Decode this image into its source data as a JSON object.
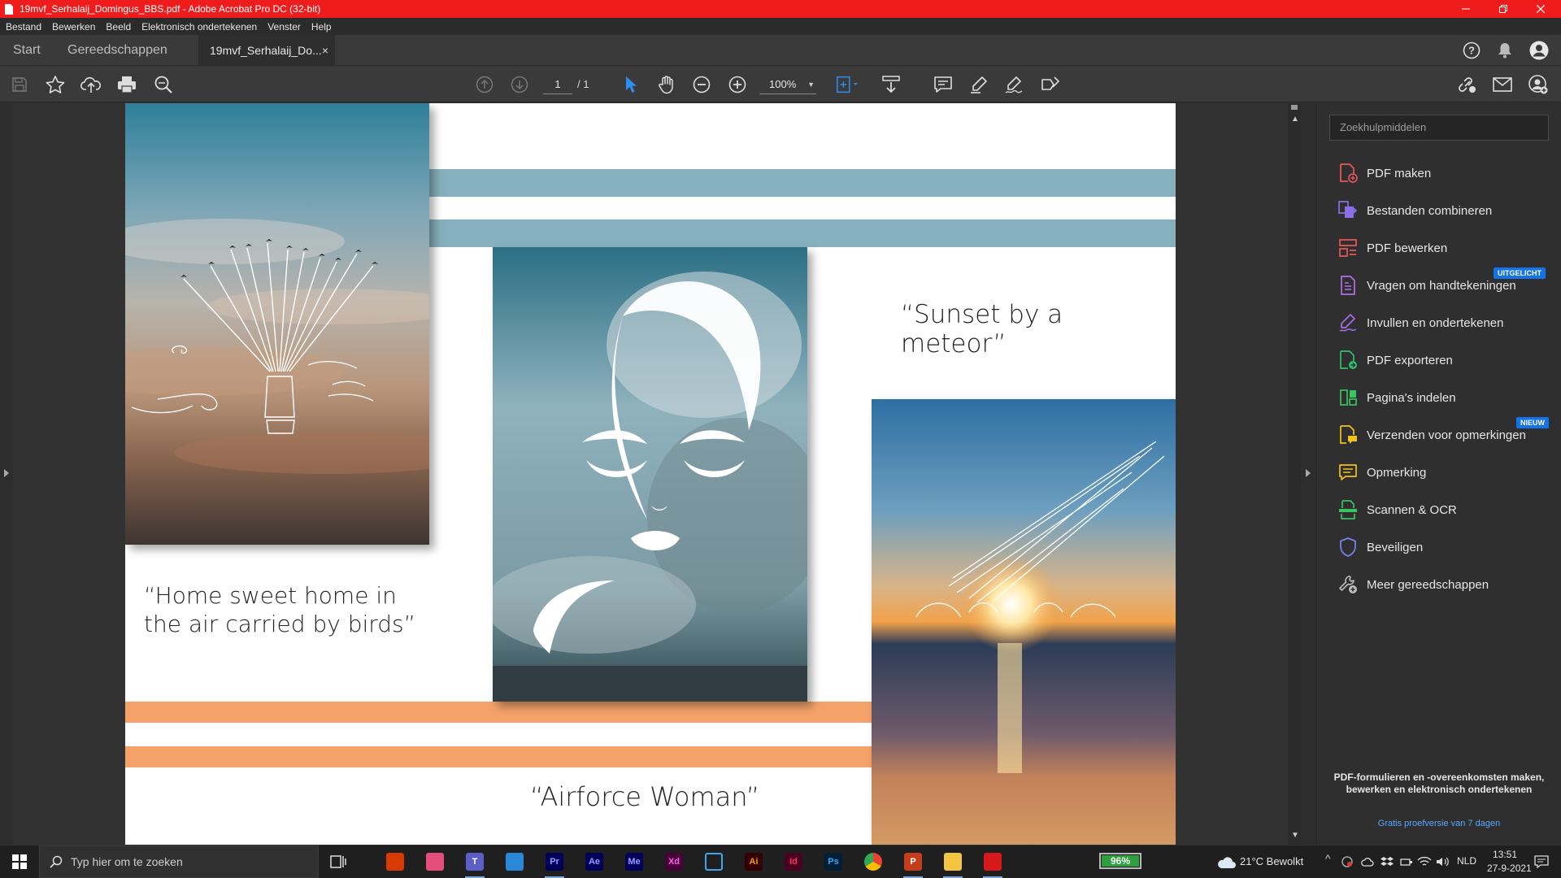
{
  "window": {
    "title": "19mvf_Serhalaij_Domingus_BBS.pdf - Adobe Acrobat Pro DC (32-bit)",
    "accent_color": "#ee1c1c"
  },
  "menu": [
    "Bestand",
    "Bewerken",
    "Beeld",
    "Elektronisch ondertekenen",
    "Venster",
    "Help"
  ],
  "tabs": {
    "home": "Start",
    "tools": "Gereedschappen",
    "document": "19mvf_Serhalaij_Do...",
    "close": "×"
  },
  "toolbar": {
    "page_current": "1",
    "page_total": "/ 1",
    "zoom": "100%"
  },
  "document": {
    "captions": {
      "meteor": "“Sunset by a meteor”",
      "birds_line1": "“Home sweet home in",
      "birds_line2": "the air carried by birds”",
      "airforce": "“Airforce Woman”"
    },
    "stripe_blue": "#87b0be",
    "stripe_orange": "#f4a269"
  },
  "tools_panel": {
    "search_placeholder": "Zoekhulpmiddelen",
    "items": [
      {
        "label": "PDF maken",
        "icon": "create-pdf-icon",
        "color": "#e8595c"
      },
      {
        "label": "Bestanden combineren",
        "icon": "combine-files-icon",
        "color": "#8a6fe8"
      },
      {
        "label": "PDF bewerken",
        "icon": "edit-pdf-icon",
        "color": "#e8595c"
      },
      {
        "label": "Vragen om handtekeningen",
        "icon": "request-signature-icon",
        "color": "#b46fe8",
        "badge": "UITGELICHT"
      },
      {
        "label": "Invullen en ondertekenen",
        "icon": "fill-sign-icon",
        "color": "#a66fe8"
      },
      {
        "label": "PDF exporteren",
        "icon": "export-pdf-icon",
        "color": "#2fbf71"
      },
      {
        "label": "Pagina's indelen",
        "icon": "organize-pages-icon",
        "color": "#3ac35e"
      },
      {
        "label": "Verzenden voor opmerkingen",
        "icon": "send-comments-icon",
        "color": "#f2c318",
        "badge": "NIEUW"
      },
      {
        "label": "Opmerking",
        "icon": "comment-icon",
        "color": "#f2c318"
      },
      {
        "label": "Scannen & OCR",
        "icon": "scan-ocr-icon",
        "color": "#3ac35e"
      },
      {
        "label": "Beveiligen",
        "icon": "protect-icon",
        "color": "#7c80e8"
      },
      {
        "label": "Meer gereedschappen",
        "icon": "more-tools-icon",
        "color": "#bdbdbd"
      }
    ],
    "promo": "PDF-formulieren en -overeenkomsten maken, bewerken en elektronisch ondertekenen",
    "trial_link": "Gratis proefversie van 7 dagen"
  },
  "taskbar": {
    "search_placeholder": "Typ hier om te zoeken",
    "apps": [
      {
        "name": "office",
        "label": "",
        "bg": "#d83b01",
        "fg": "#fff"
      },
      {
        "name": "creative-cloud",
        "label": "",
        "bg": "#e34f7a",
        "fg": "#fff"
      },
      {
        "name": "teams",
        "label": "T",
        "bg": "#5b5fc7",
        "fg": "#fff"
      },
      {
        "name": "files",
        "label": "",
        "bg": "#2b88d8",
        "fg": "#fff"
      },
      {
        "name": "premiere",
        "label": "Pr",
        "bg": "#00005b",
        "fg": "#9999ff"
      },
      {
        "name": "after-effects",
        "label": "Ae",
        "bg": "#00005b",
        "fg": "#9999ff"
      },
      {
        "name": "media-encoder",
        "label": "Me",
        "bg": "#00005b",
        "fg": "#9999ff"
      },
      {
        "name": "xd",
        "label": "Xd",
        "bg": "#470137",
        "fg": "#ff61f6"
      },
      {
        "name": "vscode",
        "label": "",
        "bg": "#1f1f1f",
        "fg": "#3ba7f1"
      },
      {
        "name": "illustrator",
        "label": "Ai",
        "bg": "#330000",
        "fg": "#ff9a00"
      },
      {
        "name": "indesign",
        "label": "Id",
        "bg": "#49021f",
        "fg": "#ff3366"
      },
      {
        "name": "photoshop",
        "label": "Ps",
        "bg": "#001e36",
        "fg": "#31a8ff"
      },
      {
        "name": "chrome",
        "label": "",
        "bg": "#1f1f1f",
        "fg": "#fff"
      },
      {
        "name": "powerpoint",
        "label": "P",
        "bg": "#c43e1c",
        "fg": "#fff"
      },
      {
        "name": "file-explorer",
        "label": "",
        "bg": "#f4c542",
        "fg": "#fff"
      },
      {
        "name": "acrobat",
        "label": "",
        "bg": "#d7191c",
        "fg": "#fff"
      }
    ],
    "battery": "96%",
    "weather": "21°C  Bewolkt",
    "language": "NLD",
    "time": "13:51",
    "date": "27-9-2021"
  }
}
